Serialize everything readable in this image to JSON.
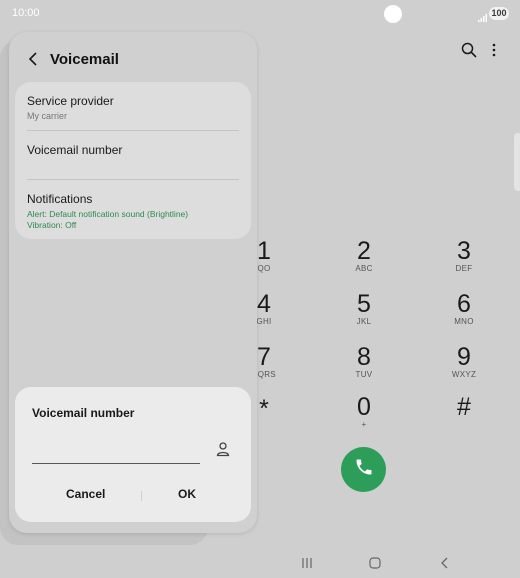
{
  "status_bar": {
    "time": "10:00",
    "battery": "100"
  },
  "voicemail_panel": {
    "title": "Voicemail",
    "service_provider": {
      "label": "Service provider",
      "value": "My carrier"
    },
    "voicemail_number": {
      "label": "Voicemail number"
    },
    "notifications": {
      "label": "Notifications",
      "alert": "Alert: Default notification sound (Brightline)",
      "vibration": "Vibration: Off"
    }
  },
  "dialog": {
    "title": "Voicemail number",
    "input_value": "",
    "cancel_label": "Cancel",
    "ok_label": "OK"
  },
  "keypad": {
    "keys": [
      {
        "digit": "1",
        "letters": "QO"
      },
      {
        "digit": "2",
        "letters": "ABC"
      },
      {
        "digit": "3",
        "letters": "DEF"
      },
      {
        "digit": "4",
        "letters": "GHI"
      },
      {
        "digit": "5",
        "letters": "JKL"
      },
      {
        "digit": "6",
        "letters": "MNO"
      },
      {
        "digit": "7",
        "letters": "PQRS"
      },
      {
        "digit": "8",
        "letters": "TUV"
      },
      {
        "digit": "9",
        "letters": "WXYZ"
      },
      {
        "digit": "*",
        "letters": ""
      },
      {
        "digit": "0",
        "letters": "+"
      },
      {
        "digit": "#",
        "letters": ""
      }
    ]
  },
  "icons": {
    "search": "search-icon",
    "more": "more-options-icon",
    "back": "back-arrow-icon",
    "contact": "contact-icon",
    "call": "phone-icon",
    "nav_recents": "recents-icon",
    "nav_home": "home-icon",
    "nav_back": "nav-back-icon"
  },
  "colors": {
    "call_green": "#2d9e5a",
    "accent_green_text": "#2f8a4f",
    "background": "#cfcfcf"
  }
}
